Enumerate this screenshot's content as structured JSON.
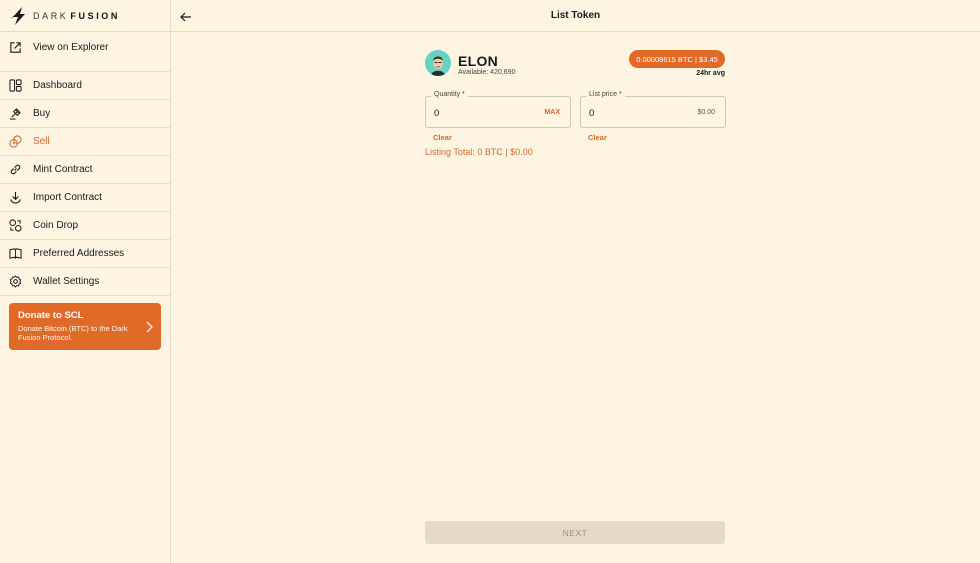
{
  "brand": {
    "name_part1": "DARK",
    "name_part2": "FUSION"
  },
  "sidebar": {
    "explorer": {
      "label": "View on Explorer",
      "icon": "external-link-icon"
    },
    "items": [
      {
        "label": "Dashboard",
        "icon": "dashboard-icon"
      },
      {
        "label": "Buy",
        "icon": "buy-icon"
      },
      {
        "label": "Sell",
        "icon": "sell-icon",
        "active": true
      },
      {
        "label": "Mint Contract",
        "icon": "link-icon"
      },
      {
        "label": "Import Contract",
        "icon": "import-icon"
      },
      {
        "label": "Coin Drop",
        "icon": "coin-drop-icon"
      },
      {
        "label": "Preferred Addresses",
        "icon": "book-icon"
      },
      {
        "label": "Wallet Settings",
        "icon": "gear-icon"
      }
    ],
    "donate": {
      "title": "Donate to SCL",
      "description": "Donate Bitcoin (BTC) to the Dark Fusion Protocol."
    }
  },
  "header": {
    "title": "List Token"
  },
  "token": {
    "name": "ELON",
    "available": "Available: 420,690",
    "price": "0.00008615 BTC | $3.45",
    "price_period": "24hr avg"
  },
  "form": {
    "quantity": {
      "label": "Quantity *",
      "value": "0",
      "suffix": "MAX",
      "clear": "Clear"
    },
    "list_price": {
      "label": "List price *",
      "value": "0",
      "suffix": "$0.00",
      "clear": "Clear"
    },
    "listing_total": "Listing Total: 0 BTC | $0.00",
    "next": "NEXT"
  },
  "colors": {
    "background": "#fdf5e2",
    "accent": "#e06a28",
    "border": "#e7dcc3",
    "disabled": "#e4dac6"
  }
}
